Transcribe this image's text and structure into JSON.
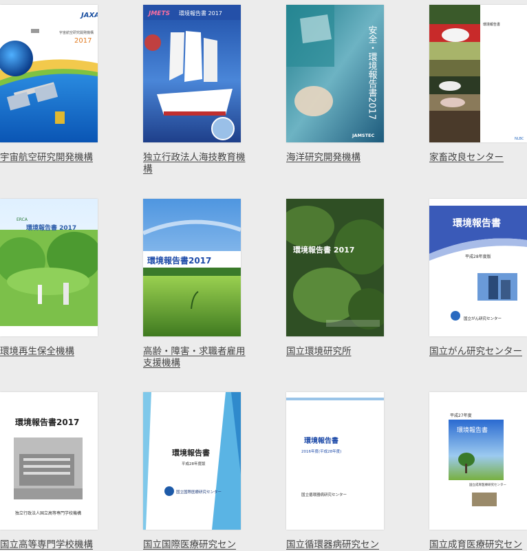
{
  "items": [
    {
      "title": "宇宙航空研究開発機構",
      "cover_text": "2017",
      "logo": "JAXA"
    },
    {
      "title": "独立行政法人海技教育機構",
      "cover_text": "環境報告書 2017",
      "logo": "JMETS"
    },
    {
      "title": "海洋研究開発機構",
      "cover_text": "安全・環境報告書2017",
      "logo": "JAMSTEC"
    },
    {
      "title": "家畜改良センター",
      "cover_text": "環境報告書",
      "logo": "NLBC"
    },
    {
      "title": "環境再生保全機構",
      "cover_text": "環境報告書 2017",
      "logo": "ERCA"
    },
    {
      "title": "高齢・障害・求職者雇用支援機構",
      "cover_text": "環境報告書2017",
      "logo": ""
    },
    {
      "title": "国立環境研究所",
      "cover_text": "環境報告書 2017",
      "logo": ""
    },
    {
      "title": "国立がん研究センター",
      "cover_text": "環境報告書",
      "cover_sub": "平成28年度版",
      "logo": "国立がん研究センター"
    },
    {
      "title": "国立高等専門学校機構",
      "cover_text": "環境報告書2017",
      "logo": "独立行政法人国立高等専門学校機構"
    },
    {
      "title": "国立国際医療研究セン",
      "cover_text": "環境報告書",
      "cover_sub": "平成28年度版",
      "logo": "国立国際医療研究センター"
    },
    {
      "title": "国立循環器病研究セン",
      "cover_text": "環境報告書",
      "cover_sub": "2016年度(平成28年度)",
      "logo": "国立循環器病研究センター"
    },
    {
      "title": "国立成育医療研究セン",
      "cover_text": "環境報告書",
      "cover_sub": "平成27年度",
      "logo": "国立成育医療研究センター"
    }
  ]
}
